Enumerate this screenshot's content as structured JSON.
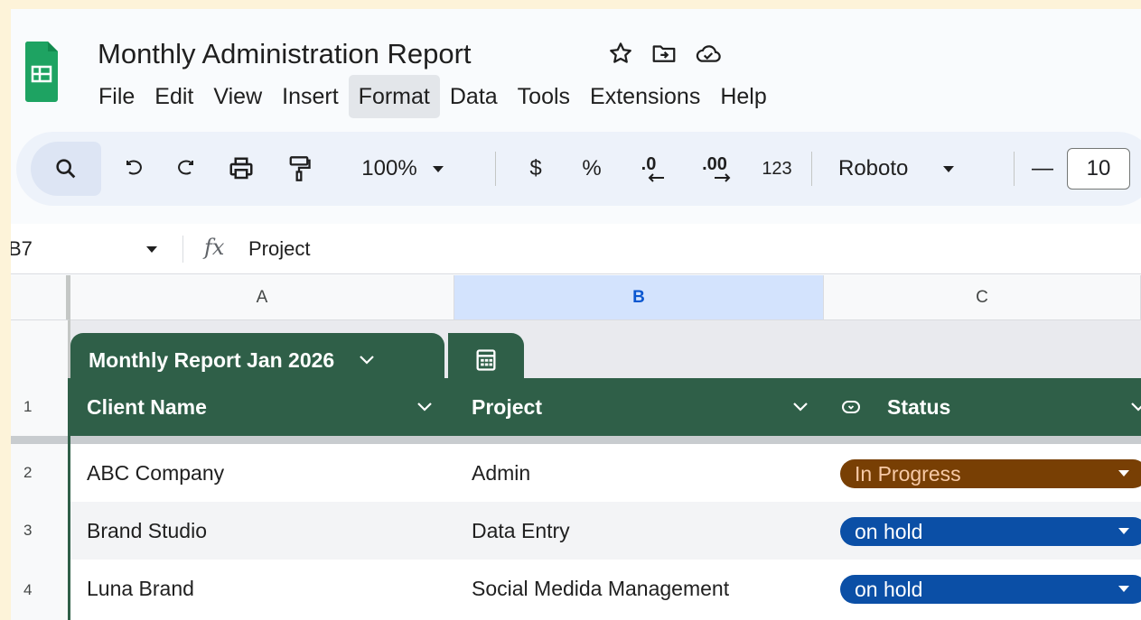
{
  "doc": {
    "title": "Monthly Administration Report"
  },
  "menu": [
    "File",
    "Edit",
    "View",
    "Insert",
    "Format",
    "Data",
    "Tools",
    "Extensions",
    "Help"
  ],
  "menu_active_index": 4,
  "toolbar": {
    "zoom": "100%",
    "currency": "$",
    "percent": "%",
    "decrease_decimal": ".0",
    "increase_decimal": ".00",
    "number_format": "123",
    "font": "Roboto",
    "minus": "—",
    "font_size": "10"
  },
  "formula_bar": {
    "cell_ref": "B7",
    "fx": "fx",
    "content": "Project"
  },
  "columns": [
    "A",
    "B",
    "C"
  ],
  "selected_column": "B",
  "table": {
    "name": "Monthly Report Jan 2026",
    "headers": [
      "Client Name",
      "Project",
      "Status"
    ],
    "rows": [
      {
        "num": "2",
        "client": "ABC Company",
        "project": "Admin",
        "status": "In Progress"
      },
      {
        "num": "3",
        "client": "Brand Studio",
        "project": "Data Entry",
        "status": "on hold"
      },
      {
        "num": "4",
        "client": "Luna Brand",
        "project": "Social Medida Management",
        "status": "on hold"
      }
    ]
  },
  "header_row_num": "1",
  "colors": {
    "table_green": "#2f5f48",
    "in_progress": "#783f04",
    "on_hold": "#0b4fa6",
    "selection": "#d3e3fd"
  },
  "icons": {
    "app": "sheets-logo-icon",
    "star": "star-icon",
    "move": "move-to-folder-icon",
    "cloud": "cloud-saved-icon",
    "search": "search-icon",
    "undo": "undo-icon",
    "redo": "redo-icon",
    "print": "print-icon",
    "paint": "paint-format-icon",
    "table_view": "table-view-icon",
    "status_type": "dropdown-type-icon"
  }
}
